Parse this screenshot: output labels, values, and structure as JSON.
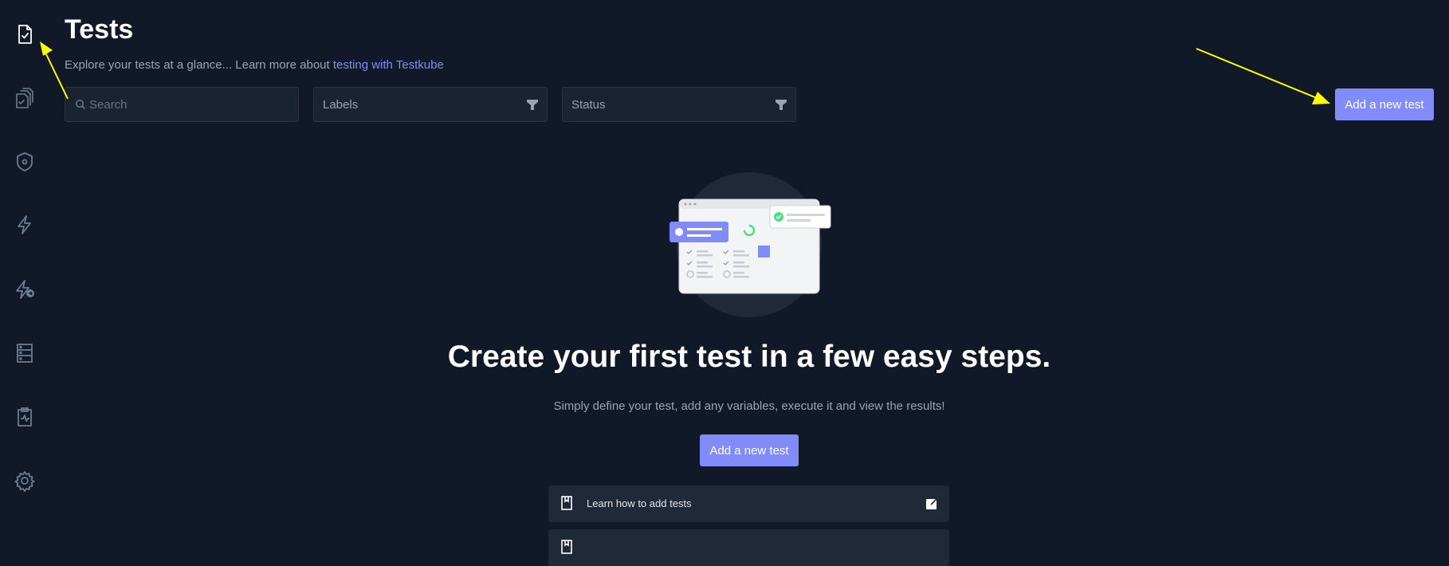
{
  "sidebar": {
    "items": [
      {
        "name": "tests",
        "icon": "file-check-icon",
        "active": true
      },
      {
        "name": "test-suites",
        "icon": "stacked-files-icon"
      },
      {
        "name": "executors",
        "icon": "shield-gear-icon"
      },
      {
        "name": "triggers",
        "icon": "lightning-icon"
      },
      {
        "name": "webhooks",
        "icon": "lightning-arrow-icon"
      },
      {
        "name": "sources",
        "icon": "server-stack-icon"
      },
      {
        "name": "status-pages",
        "icon": "clipboard-pulse-icon"
      },
      {
        "name": "settings",
        "icon": "gear-icon"
      }
    ]
  },
  "header": {
    "title": "Tests",
    "subtitle_text": "Explore your tests at a glance... Learn more about ",
    "subtitle_link": "testing with Testkube"
  },
  "filters": {
    "search_placeholder": "Search",
    "labels": "Labels",
    "status": "Status"
  },
  "actions": {
    "add_test": "Add a new test"
  },
  "empty_state": {
    "heading": "Create your first test in a few easy steps.",
    "description": "Simply define your test, add any variables, execute it and view the results!",
    "button": "Add a new test",
    "links": [
      {
        "label": "Learn how to add tests"
      },
      {
        "label": ""
      }
    ]
  },
  "colors": {
    "background": "#111827",
    "accent": "#818cf8",
    "annotation": "#ffff00"
  }
}
